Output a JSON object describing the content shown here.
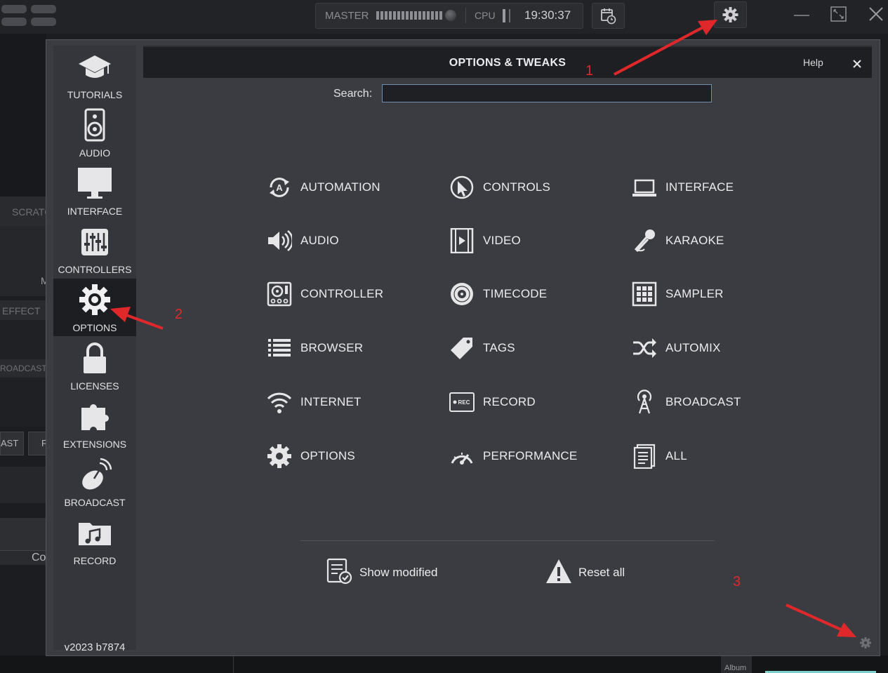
{
  "topbar": {
    "master_label": "MASTER",
    "cpu_label": "CPU",
    "clock": "19:30:37"
  },
  "background": {
    "scratch_label": "SCRATC",
    "m_label": "M",
    "effect_label": "EFFECT",
    "broadcast_label": "ROADCAST",
    "ast_label": "AST",
    "f_label": "F",
    "co_label": "Co",
    "album_label": "Album"
  },
  "nav": {
    "items": [
      {
        "label": "TUTORIALS",
        "icon": "graduation-cap-icon"
      },
      {
        "label": "AUDIO",
        "icon": "speaker-icon"
      },
      {
        "label": "INTERFACE",
        "icon": "monitor-icon"
      },
      {
        "label": "CONTROLLERS",
        "icon": "sliders-icon"
      },
      {
        "label": "OPTIONS",
        "icon": "gear-icon",
        "active": true
      },
      {
        "label": "LICENSES",
        "icon": "lock-icon"
      },
      {
        "label": "EXTENSIONS",
        "icon": "puzzle-icon"
      },
      {
        "label": "BROADCAST",
        "icon": "satellite-dish-icon"
      },
      {
        "label": "RECORD",
        "icon": "music-folder-icon"
      }
    ],
    "version": "v2023 b7874"
  },
  "dialog": {
    "title": "OPTIONS & TWEAKS",
    "help": "Help",
    "search_label": "Search:",
    "search_value": ""
  },
  "categories": [
    {
      "label": "AUTOMATION",
      "icon": "automation-icon"
    },
    {
      "label": "CONTROLS",
      "icon": "cursor-icon"
    },
    {
      "label": "INTERFACE",
      "icon": "laptop-icon"
    },
    {
      "label": "AUDIO",
      "icon": "volume-icon"
    },
    {
      "label": "VIDEO",
      "icon": "film-icon"
    },
    {
      "label": "KARAOKE",
      "icon": "microphone-icon"
    },
    {
      "label": "CONTROLLER",
      "icon": "controller-icon"
    },
    {
      "label": "TIMECODE",
      "icon": "vinyl-icon"
    },
    {
      "label": "SAMPLER",
      "icon": "pads-grid-icon"
    },
    {
      "label": "BROWSER",
      "icon": "list-icon"
    },
    {
      "label": "TAGS",
      "icon": "tag-icon"
    },
    {
      "label": "AUTOMIX",
      "icon": "shuffle-icon"
    },
    {
      "label": "INTERNET",
      "icon": "wifi-icon"
    },
    {
      "label": "RECORD",
      "icon": "rec-icon"
    },
    {
      "label": "BROADCAST",
      "icon": "antenna-icon"
    },
    {
      "label": "OPTIONS",
      "icon": "gear-icon"
    },
    {
      "label": "PERFORMANCE",
      "icon": "gauge-icon"
    },
    {
      "label": "ALL",
      "icon": "document-icon"
    }
  ],
  "footer": {
    "show_modified": "Show modified",
    "reset_all": "Reset all"
  },
  "annotations": [
    "1",
    "2",
    "3"
  ],
  "colors": {
    "annotation_red": "#e0282b",
    "dialog_bg": "#3b3c41",
    "header_bg": "#1e1f22",
    "active_nav_bg": "#1d1e21"
  }
}
